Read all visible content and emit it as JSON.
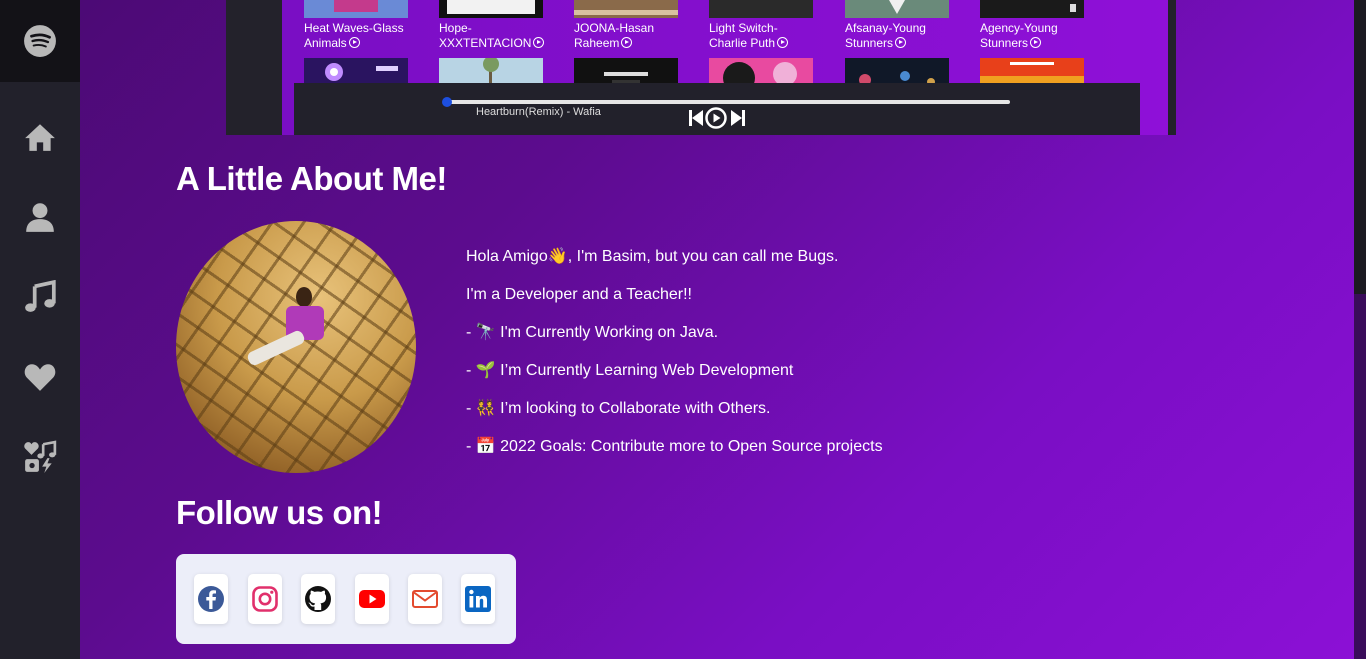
{
  "sidebar": {
    "items": [
      {
        "icon": "spotify-logo-icon"
      },
      {
        "icon": "home-icon"
      },
      {
        "icon": "user-icon"
      },
      {
        "icon": "music-icon"
      },
      {
        "icon": "heart-icon"
      },
      {
        "icon": "music-collection-icon"
      }
    ]
  },
  "albums": [
    {
      "title_line1": "Heat Waves-Glass",
      "title_line2": "Animals"
    },
    {
      "title_line1": "Hope-",
      "title_line2": "XXXTENTACION"
    },
    {
      "title_line1": "JOONA-Hasan",
      "title_line2": "Raheem"
    },
    {
      "title_line1": "Light Switch-",
      "title_line2": "Charlie Puth"
    },
    {
      "title_line1": "Afsanay-Young",
      "title_line2": "Stunners"
    },
    {
      "title_line1": "Agency-Young",
      "title_line2": "Stunners"
    }
  ],
  "player": {
    "now_playing": "Heartburn(Remix) - Wafia",
    "progress": 0.0
  },
  "about": {
    "title": "A Little About Me!",
    "lines": [
      "Hola Amigo👋, I'm Basim, but you can call me Bugs.",
      "I'm a Developer and a Teacher!!",
      "- 🔭 I'm Currently Working on Java.",
      "- 🌱 I’m Currently Learning Web Development",
      "- 👯 I’m looking to Collaborate with Others.",
      "- 📅 2022 Goals: Contribute more to Open Source projects"
    ]
  },
  "follow": {
    "title": "Follow us on!",
    "links": [
      {
        "icon": "facebook-icon",
        "color": "#3b5998"
      },
      {
        "icon": "instagram-icon",
        "color": "#e1306c"
      },
      {
        "icon": "github-icon",
        "color": "#111111"
      },
      {
        "icon": "youtube-icon",
        "color": "#ff0000"
      },
      {
        "icon": "mail-icon",
        "color": "#e34b2f"
      },
      {
        "icon": "linkedin-icon",
        "color": "#0a66c2"
      }
    ]
  },
  "colors": {
    "sidebar_bg": "#22212b",
    "accent_purple": "#8c10d6",
    "progress_knob": "#1d4fe0"
  }
}
